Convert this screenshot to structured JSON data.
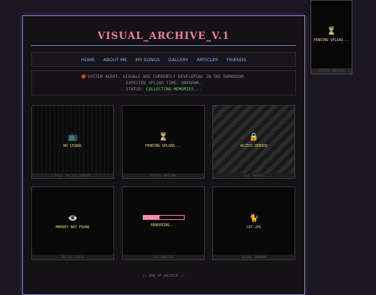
{
  "header": {
    "title": "VISUAL_ARCHIVE_V.1"
  },
  "nav": {
    "items": [
      "HOME",
      "ABOUT ME",
      "MY SONGS",
      "GALLERY",
      "ARTICLES",
      "FRIENDS"
    ]
  },
  "alert": {
    "line1": "SYSTEM ALERT: VISUALS ARE CURRENTLY DEVELOPING IN THE DARKROOM.",
    "line2": "EXPECTED UPLOAD TIME: UNKNOWN.",
    "status_label": "STATUS:",
    "status_value": "COLLECTING MEMORIES...",
    "colors": {
      "dot": "#e0382f",
      "status": "#5fd25b"
    }
  },
  "cards": [
    {
      "icon": "tv-icon",
      "glyph": "📺",
      "caption": "NO SIGNAL",
      "footer": "FILE: IMG_001_CORRUPT"
    },
    {
      "icon": "hourglass-icon",
      "glyph": "⏳",
      "caption": "PENDING UPLOAD...",
      "footer": "STATUS: WAITING"
    },
    {
      "icon": "lock-icon",
      "glyph": "🔒",
      "caption": "ACCESS DENIED",
      "footer": "FILE: PRIVATE"
    },
    {
      "icon": "eye-icon",
      "glyph": "👁️",
      "caption": "MEMORY NOT FOUND",
      "footer": "ERR_404_VISUAL"
    },
    {
      "icon": "progress-bar",
      "caption": "RENDERING...",
      "footer": "90% COMPLETE",
      "progress": 0.4
    },
    {
      "icon": "cat-icon",
      "glyph": "🐈",
      "caption": "CAT.JPG",
      "footer": "VISUAL: UNKNOWN"
    }
  ],
  "side_card": {
    "icon": "hourglass-icon",
    "glyph": "⏳",
    "caption": "PENDING UPLOAD...",
    "footer": "STATUS: WAITING"
  },
  "footer": {
    "text": "// END OF ARCHIVE //"
  },
  "colors": {
    "title": "#f07b9e",
    "nav_link": "#7fb1ff",
    "border_accent": "#8b86c8",
    "caption": "#f0d86a",
    "progress": "#f58bb0"
  }
}
